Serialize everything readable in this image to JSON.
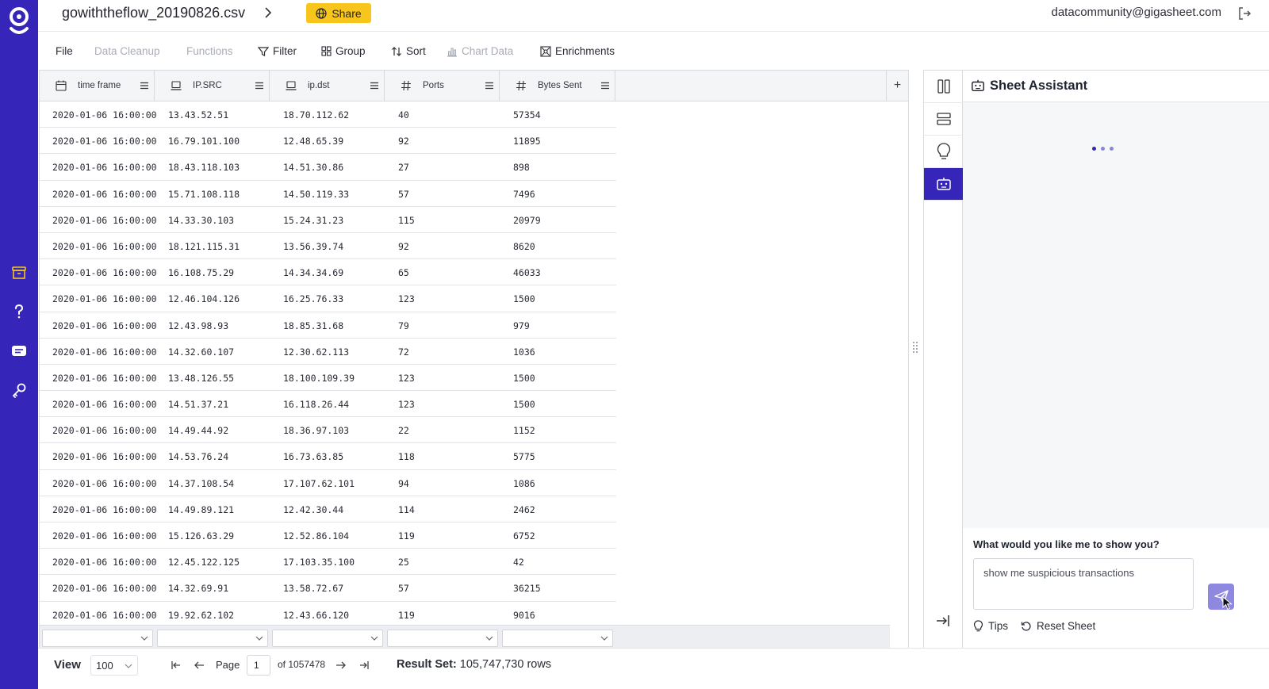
{
  "header": {
    "file_title": "gowiththeflow_20190826.csv",
    "share_label": "Share",
    "user_email": "datacommunity@gigasheet.com"
  },
  "toolbar": {
    "items": [
      {
        "label": "File",
        "enabled": true,
        "icon": ""
      },
      {
        "label": "Data Cleanup",
        "enabled": false,
        "icon": ""
      },
      {
        "label": "Functions",
        "enabled": false,
        "icon": ""
      },
      {
        "label": "Filter",
        "enabled": true,
        "icon": "filter-icon"
      },
      {
        "label": "Group",
        "enabled": true,
        "icon": "group-icon"
      },
      {
        "label": "Sort",
        "enabled": true,
        "icon": "sort-icon"
      },
      {
        "label": "Chart Data",
        "enabled": false,
        "icon": "chart-icon"
      },
      {
        "label": "Enrichments",
        "enabled": true,
        "icon": "enrichments-icon"
      }
    ]
  },
  "grid": {
    "columns": [
      {
        "label": "time frame",
        "icon": "calendar-icon"
      },
      {
        "label": "IP.SRC",
        "icon": "laptop-icon"
      },
      {
        "label": "ip.dst",
        "icon": "laptop-icon"
      },
      {
        "label": "Ports",
        "icon": "hash-icon"
      },
      {
        "label": "Bytes Sent",
        "icon": "hash-icon"
      }
    ],
    "rows": [
      [
        "2020-01-06 16:00:00",
        "13.43.52.51",
        "18.70.112.62",
        "40",
        "57354"
      ],
      [
        "2020-01-06 16:00:00",
        "16.79.101.100",
        "12.48.65.39",
        "92",
        "11895"
      ],
      [
        "2020-01-06 16:00:00",
        "18.43.118.103",
        "14.51.30.86",
        "27",
        "898"
      ],
      [
        "2020-01-06 16:00:00",
        "15.71.108.118",
        "14.50.119.33",
        "57",
        "7496"
      ],
      [
        "2020-01-06 16:00:00",
        "14.33.30.103",
        "15.24.31.23",
        "115",
        "20979"
      ],
      [
        "2020-01-06 16:00:00",
        "18.121.115.31",
        "13.56.39.74",
        "92",
        "8620"
      ],
      [
        "2020-01-06 16:00:00",
        "16.108.75.29",
        "14.34.34.69",
        "65",
        "46033"
      ],
      [
        "2020-01-06 16:00:00",
        "12.46.104.126",
        "16.25.76.33",
        "123",
        "1500"
      ],
      [
        "2020-01-06 16:00:00",
        "12.43.98.93",
        "18.85.31.68",
        "79",
        "979"
      ],
      [
        "2020-01-06 16:00:00",
        "14.32.60.107",
        "12.30.62.113",
        "72",
        "1036"
      ],
      [
        "2020-01-06 16:00:00",
        "13.48.126.55",
        "18.100.109.39",
        "123",
        "1500"
      ],
      [
        "2020-01-06 16:00:00",
        "14.51.37.21",
        "16.118.26.44",
        "123",
        "1500"
      ],
      [
        "2020-01-06 16:00:00",
        "14.49.44.92",
        "18.36.97.103",
        "22",
        "1152"
      ],
      [
        "2020-01-06 16:00:00",
        "14.53.76.24",
        "16.73.63.85",
        "118",
        "5775"
      ],
      [
        "2020-01-06 16:00:00",
        "14.37.108.54",
        "17.107.62.101",
        "94",
        "1086"
      ],
      [
        "2020-01-06 16:00:00",
        "14.49.89.121",
        "12.42.30.44",
        "114",
        "2462"
      ],
      [
        "2020-01-06 16:00:00",
        "15.126.63.29",
        "12.52.86.104",
        "119",
        "6752"
      ],
      [
        "2020-01-06 16:00:00",
        "12.45.122.125",
        "17.103.35.100",
        "25",
        "42"
      ],
      [
        "2020-01-06 16:00:00",
        "14.32.69.91",
        "13.58.72.67",
        "57",
        "36215"
      ],
      [
        "2020-01-06 16:00:00",
        "19.92.62.102",
        "12.43.66.120",
        "119",
        "9016"
      ]
    ]
  },
  "footer": {
    "view_label": "View",
    "page_size": "100",
    "page_label": "Page",
    "page_value": "1",
    "of_pages": "of 1057478",
    "result_label": "Result Set:",
    "result_value": "105,747,730 rows"
  },
  "assistant": {
    "title": "Sheet Assistant",
    "question": "What would you like me to show you?",
    "input_value": "show me suspicious transactions",
    "tips_label": "Tips",
    "reset_label": "Reset Sheet"
  },
  "colors": {
    "brand": "#3525b8",
    "share": "#f7c51b",
    "send_button": "#8f88e0"
  }
}
